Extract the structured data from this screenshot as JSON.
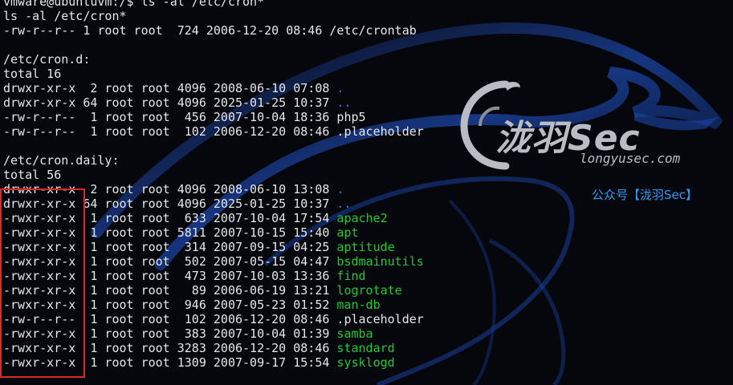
{
  "terminal": {
    "lines": [
      {
        "text": "vmware@ubuntuvm:/$ ls -al /etc/cron*"
      },
      {
        "text": "ls -al /etc/cron*"
      },
      {
        "text": "-rw-r--r-- 1 root root  724 2006-12-20 08:46 /etc/crontab"
      },
      {
        "text": ""
      },
      {
        "text": "/etc/cron.d:"
      },
      {
        "text": "total 16"
      },
      {
        "text": "drwxr-xr-x  2 root root 4096 2008-06-10 07:08 ",
        "name": ".",
        "color": "blue"
      },
      {
        "text": "drwxr-xr-x 64 root root 4096 2025-01-25 10:37 ",
        "name": "..",
        "color": "blue"
      },
      {
        "text": "-rw-r--r--  1 root root  456 2007-10-04 18:36 ",
        "name": "php5",
        "color": "white"
      },
      {
        "text": "-rw-r--r--  1 root root  102 2006-12-20 08:46 ",
        "name": ".placeholder",
        "color": "white"
      },
      {
        "text": ""
      },
      {
        "text": "/etc/cron.daily:"
      },
      {
        "text": "total 56"
      },
      {
        "text": "drwxr-xr-x  2 root root 4096 2008-06-10 13:08 ",
        "name": ".",
        "color": "blue"
      },
      {
        "text": "drwxr-xr-x 64 root root 4096 2025-01-25 10:37 ",
        "name": "..",
        "color": "blue"
      },
      {
        "text": "-rwxr-xr-x  1 root root  633 2007-10-04 17:54 ",
        "name": "apache2",
        "color": "green"
      },
      {
        "text": "-rwxr-xr-x  1 root root 5811 2007-10-15 15:40 ",
        "name": "apt",
        "color": "green"
      },
      {
        "text": "-rwxr-xr-x  1 root root  314 2007-09-15 04:25 ",
        "name": "aptitude",
        "color": "green"
      },
      {
        "text": "-rwxr-xr-x  1 root root  502 2007-05-15 04:47 ",
        "name": "bsdmainutils",
        "color": "green"
      },
      {
        "text": "-rwxr-xr-x  1 root root  473 2007-10-03 13:36 ",
        "name": "find",
        "color": "green"
      },
      {
        "text": "-rwxr-xr-x  1 root root   89 2006-06-19 13:21 ",
        "name": "logrotate",
        "color": "green"
      },
      {
        "text": "-rwxr-xr-x  1 root root  946 2007-05-23 01:52 ",
        "name": "man-db",
        "color": "green"
      },
      {
        "text": "-rw-r--r--  1 root root  102 2006-12-20 08:46 ",
        "name": ".placeholder",
        "color": "white"
      },
      {
        "text": "-rwxr-xr-x  1 root root  383 2007-10-04 01:39 ",
        "name": "samba",
        "color": "green"
      },
      {
        "text": "-rwxr-xr-x  1 root root 3283 2006-12-20 08:46 ",
        "name": "standard",
        "color": "green"
      },
      {
        "text": "-rwxr-xr-x  1 root root 1309 2007-09-17 15:54 ",
        "name": "sysklogd",
        "color": "green"
      }
    ]
  },
  "watermark": {
    "brand": "泷羽Sec",
    "site": "longyusec.com",
    "wechat": "公众号【泷羽Sec】",
    "icon": "dragon-icon"
  },
  "colors": {
    "background": "#06070d",
    "text": "#e6e6e6",
    "directory": "#3b6fd8",
    "executable": "#1ecb2e",
    "highlight_box": "#e0262a",
    "watermark_link": "#2e9cf0"
  }
}
